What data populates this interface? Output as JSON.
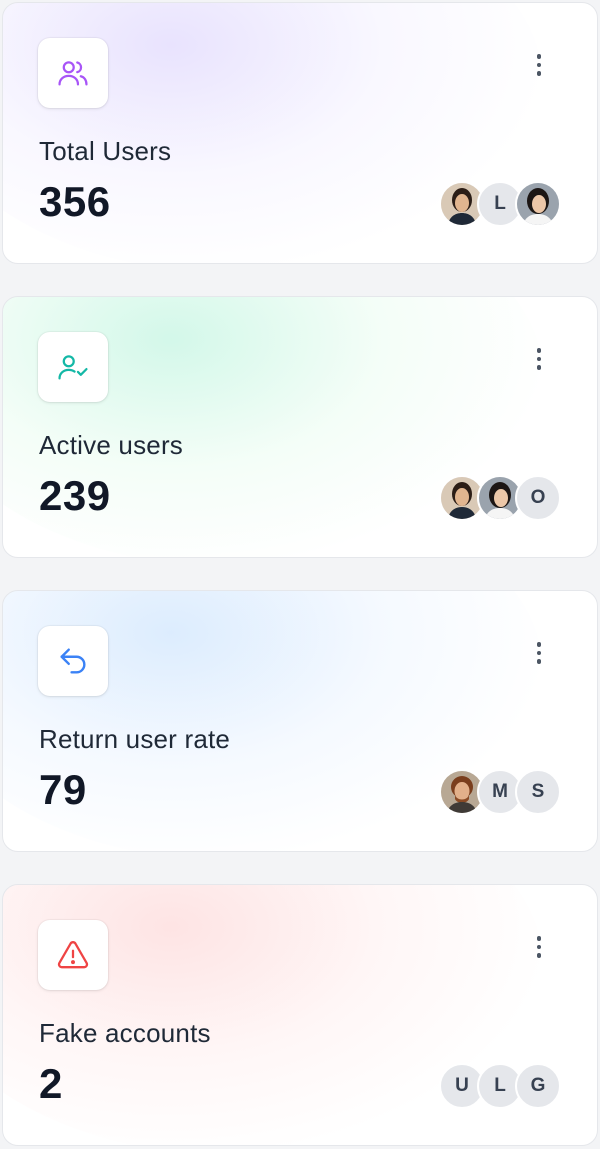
{
  "cards": [
    {
      "label": "Total Users",
      "value": "356",
      "icon": "users-icon",
      "accent": "#a855f7",
      "avatars": [
        {
          "type": "photo",
          "name": "user-photo-1"
        },
        {
          "type": "initial",
          "initial": "L"
        },
        {
          "type": "photo",
          "name": "user-photo-2"
        }
      ]
    },
    {
      "label": "Active users",
      "value": "239",
      "icon": "user-check-icon",
      "accent": "#14b8a6",
      "avatars": [
        {
          "type": "photo",
          "name": "user-photo-1"
        },
        {
          "type": "photo",
          "name": "user-photo-2"
        },
        {
          "type": "initial",
          "initial": "O"
        }
      ]
    },
    {
      "label": "Return user rate",
      "value": "79",
      "icon": "return-arrow-icon",
      "accent": "#3b82f6",
      "avatars": [
        {
          "type": "photo",
          "name": "user-photo-3"
        },
        {
          "type": "initial",
          "initial": "M"
        },
        {
          "type": "initial",
          "initial": "S"
        }
      ]
    },
    {
      "label": "Fake accounts",
      "value": "2",
      "icon": "warning-triangle-icon",
      "accent": "#ef4444",
      "avatars": [
        {
          "type": "initial",
          "initial": "U"
        },
        {
          "type": "initial",
          "initial": "L"
        },
        {
          "type": "initial",
          "initial": "G"
        }
      ]
    }
  ]
}
